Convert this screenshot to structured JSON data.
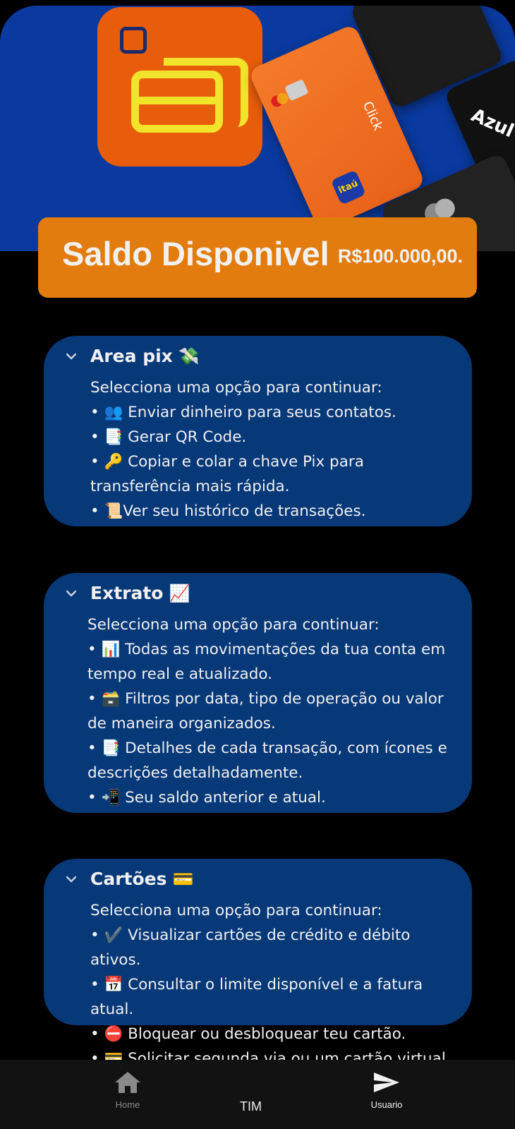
{
  "hero": {
    "card_texts": {
      "bank": "itaú",
      "brand": "Click",
      "azul": "Azul"
    }
  },
  "balance": {
    "label": "Saldo Disponivel",
    "value": "R$100.000,00."
  },
  "sections": [
    {
      "title": "Area pix",
      "emoji": "💸",
      "lines": [
        "Selecciona uma opção para continuar:",
        "• 👥 Enviar dinheiro para seus contatos.",
        "• 📑 Gerar QR Code.",
        "• 🔑 Copiar e colar a chave Pix para transferência mais rápida.",
        "• 📜Ver seu histórico de transações."
      ]
    },
    {
      "title": "Extrato",
      "emoji": "📈",
      "lines": [
        "Selecciona uma opção para continuar:",
        "• 📊 Todas as movimentações da tua conta em tempo real e atualizado.",
        "• 🗃️ Filtros por data, tipo de operação ou valor de maneira organizados.",
        "• 📑 Detalhes de cada transação, com ícones e descrições detalhadamente.",
        "• 📲 Seu saldo anterior e atual."
      ]
    },
    {
      "title": "Cartões",
      "emoji": "💳",
      "lines": [
        "Selecciona uma opção para continuar:",
        "• ✔️ Visualizar cartões de crédito e débito ativos.",
        "• 📅 Consultar o limite disponível e a fatura atual.",
        "• ⛔ Bloquear ou desbloquear teu cartão.",
        "• 💳 Solicitar segunda via ou um cartão virtual."
      ]
    }
  ],
  "nav": {
    "home_label": "Home",
    "user_label": "Usuario",
    "home_icon": "home-icon",
    "user_icon": "send-icon"
  },
  "carrier": "TIM",
  "colors": {
    "hero_bg": "#0a3aa0",
    "balance_bg": "#e37c0e",
    "section_bg": "#073878",
    "nav_bg": "#121212"
  }
}
